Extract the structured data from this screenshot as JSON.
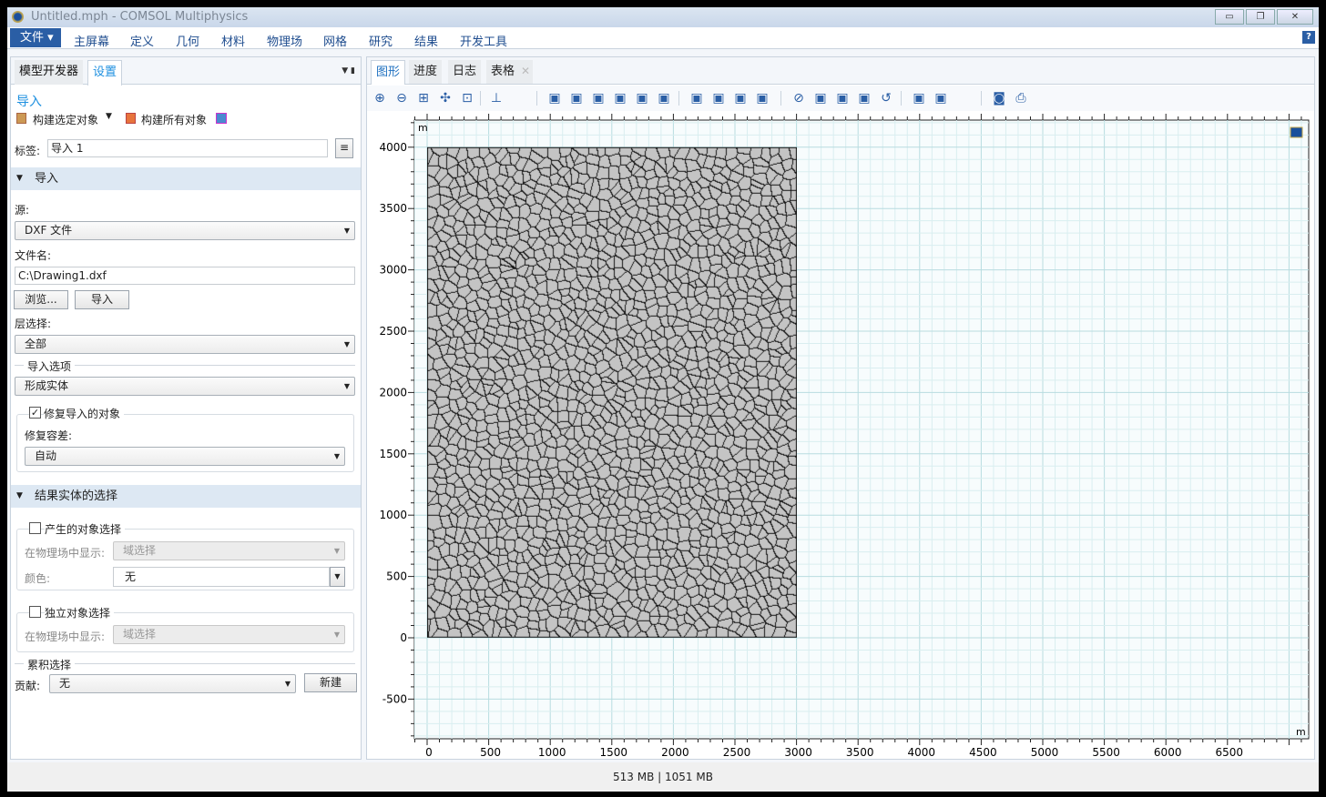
{
  "window": {
    "title": "Untitled.mph - COMSOL Multiphysics",
    "buttons": [
      "minimize",
      "restore",
      "close"
    ]
  },
  "menubar": {
    "file": "文件 ▾",
    "items": [
      "主屏幕",
      "定义",
      "几何",
      "材料",
      "物理场",
      "网格",
      "研究",
      "结果",
      "开发工具"
    ],
    "help": "?"
  },
  "left_panel": {
    "tabs": [
      "模型开发器",
      "设置"
    ],
    "active_tab": "设置",
    "heading": "导入",
    "build_selected": "构建选定对象",
    "build_all": "构建所有对象",
    "label_caption": "标签:",
    "label_value": "导入 1",
    "section_import": "导入",
    "source_caption": "源:",
    "source_value": "DXF 文件",
    "filename_caption": "文件名:",
    "filename_value": "C:\\Drawing1.dxf",
    "browse": "浏览...",
    "import": "导入",
    "layer_caption": "层选择:",
    "layer_value": "全部",
    "import_options": "导入选项",
    "form_value": "形成实体",
    "repair_label": "修复导入的对象",
    "repair_checked": true,
    "tolerance_caption": "修复容差:",
    "tolerance_value": "自动",
    "section_result": "结果实体的选择",
    "generated_label": "产生的对象选择",
    "generated_checked": false,
    "show_in_physics": "在物理场中显示:",
    "domain_selection": "域选择",
    "color_caption": "颜色:",
    "color_value": "无",
    "independent_label": "独立对象选择",
    "independent_checked": false,
    "show_in_physics2": "在物理场中显示:",
    "domain_selection2": "域选择",
    "cumulative": "累积选择",
    "contribute_caption": "贡献:",
    "contribute_value": "无",
    "new_button": "新建"
  },
  "graphics": {
    "tabs": [
      "图形",
      "进度",
      "日志",
      "表格"
    ],
    "active_tab": "图形",
    "toolbar_icons": [
      "zoom-in",
      "zoom-out",
      "zoom-box",
      "zoom-extents",
      "zoom-selected",
      "axis-orientation",
      "select-object",
      "select-domain",
      "select-boundary",
      "select-edge",
      "select-point",
      "deselect",
      "build-selected",
      "build-all",
      "box-select",
      "paint-select",
      "hide",
      "show-all",
      "hide-selected",
      "show-selected",
      "reset-hiding",
      "material-clear",
      "color-scheme",
      "screenshot",
      "print"
    ],
    "unit_x": "m",
    "unit_y": "m",
    "x_ticks": [
      0,
      500,
      1000,
      1500,
      2000,
      2500,
      3000,
      3500,
      4000,
      4500,
      5000,
      5500,
      6000,
      6500
    ],
    "y_ticks": [
      -500,
      0,
      500,
      1000,
      1500,
      2000,
      2500,
      3000,
      3500,
      4000
    ],
    "geometry_extent": {
      "x": [
        0,
        3000
      ],
      "y": [
        0,
        4000
      ]
    },
    "geometry_color": "#c4c4c4"
  },
  "status": {
    "memory": "513 MB | 1051 MB"
  }
}
